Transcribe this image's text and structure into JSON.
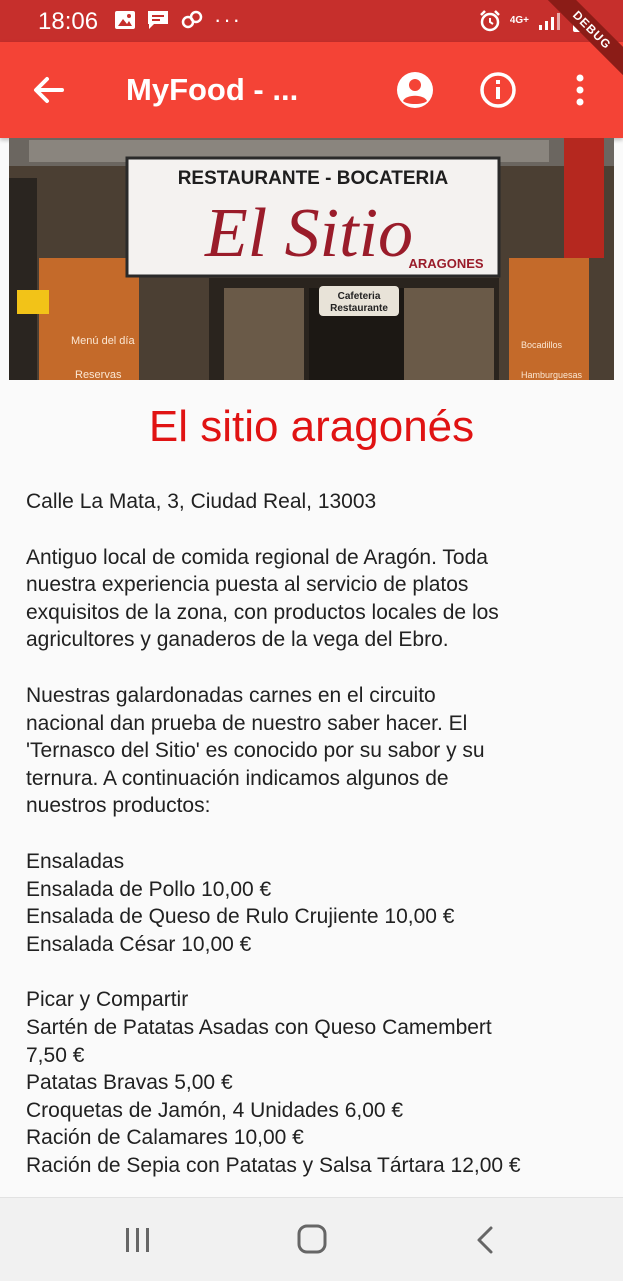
{
  "status_bar": {
    "time": "18:06",
    "network_label": "4G+",
    "overflow_dots": "···",
    "debug_label": "DEBUG"
  },
  "app_bar": {
    "title": "MyFood - ...",
    "color": "#f44336"
  },
  "hero_image": {
    "sign_top": "RESTAURANTE - BOCATERIA",
    "sign_main": "El Sitio",
    "sign_sub": "ARAGONES",
    "door_sign_1": "Cafeteria",
    "door_sign_2": "Restaurante",
    "left_panel_1": "Menú del día",
    "left_panel_2": "Reservas",
    "right_panel_1": "Bocadillos",
    "right_panel_2": "Hamburguesas"
  },
  "restaurant": {
    "name": "El sitio aragonés",
    "address": "Calle La Mata, 3, Ciudad Real, 13003",
    "description_1": [
      "Antiguo local de comida regional de Aragón. Toda",
      "nuestra experiencia puesta al servicio de platos",
      "exquisitos de la zona, con productos locales de los",
      "agricultores y ganaderos de la vega del Ebro."
    ],
    "description_2": [
      "Nuestras galardonadas carnes en el circuito",
      "nacional dan prueba de nuestro saber hacer. El",
      "'Ternasco del Sitio' es conocido por su sabor y su",
      "ternura. A continuación indicamos algunos de",
      "nuestros productos:"
    ],
    "menu": [
      {
        "category": "Ensaladas",
        "items": [
          "Ensalada de Pollo 10,00 €",
          "Ensalada de Queso de Rulo Crujiente 10,00 €",
          "Ensalada César 10,00 €"
        ]
      },
      {
        "category": "Picar y Compartir",
        "items": [
          "Sartén de Patatas Asadas con Queso Camembert",
          "7,50 €",
          "Patatas Bravas 5,00 €",
          "Croquetas de Jamón, 4 Unidades 6,00 €",
          "Ración de Calamares 10,00 €",
          "Ración de Sepia con Patatas y Salsa Tártara 12,00 €"
        ]
      }
    ]
  },
  "colors": {
    "status_bar": "#c62f2c",
    "title_red": "#e01313",
    "text": "#212121"
  }
}
